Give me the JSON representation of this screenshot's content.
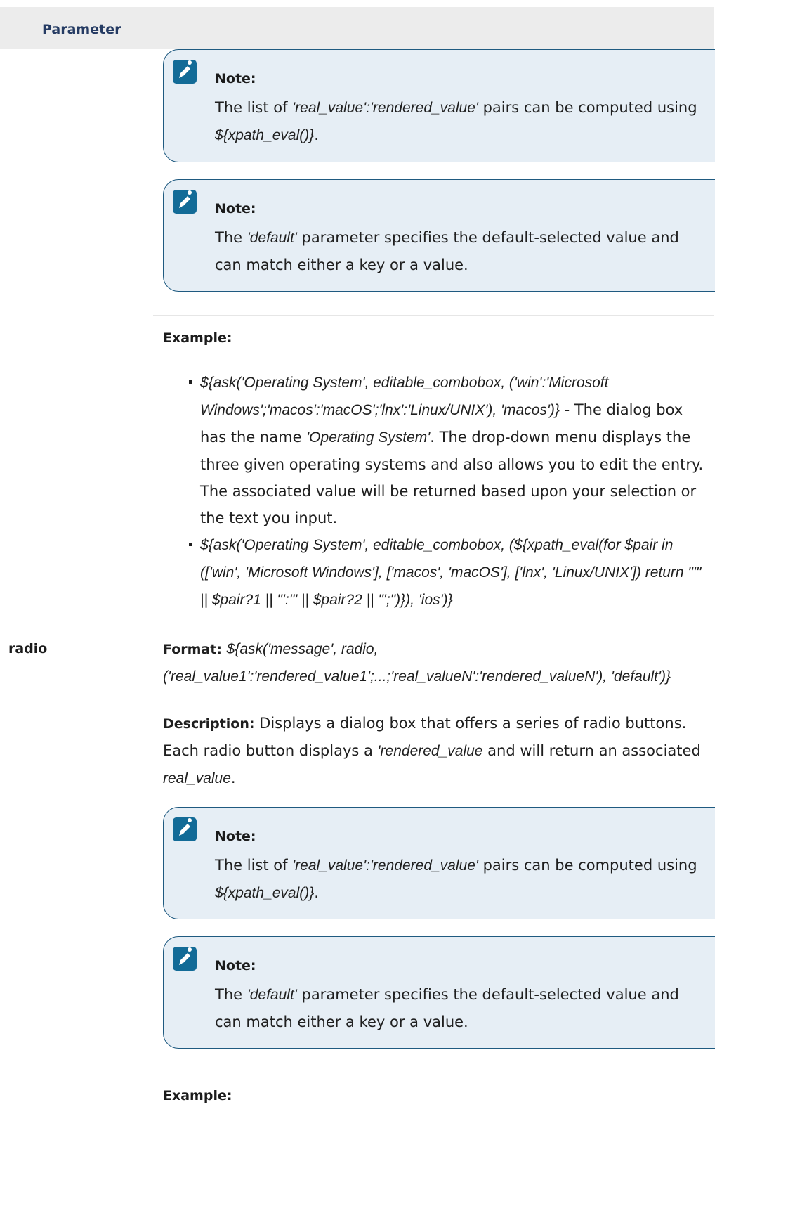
{
  "table": {
    "header": {
      "column1": "Parameter"
    }
  },
  "top_block": {
    "notes": [
      {
        "label": "Note:",
        "text_pre": "The list of ",
        "text_italic": "'real_value':'rendered_value'",
        "text_mid": " pairs can be computed using ",
        "text_italic2": "${xpath_eval()}",
        "text_post": "."
      },
      {
        "label": "Note:",
        "text_pre": "The ",
        "text_italic": "'default'",
        "text_post": " parameter specifies the default-selected value and can match either a key or a value."
      }
    ],
    "example_label": "Example:",
    "examples": [
      {
        "code": "${ask('Operating System', editable_combobox, ('win':'Microsoft Windows';'macos':'macOS';'lnx':'Linux/UNIX'), 'macos')}",
        "desc_pre": " - The dialog box has the name ",
        "desc_italic": "'Operating System'",
        "desc_post": ". The drop-down menu displays the three given operating systems and also allows you to edit the entry. The associated value will be returned based upon your selection or the text you input."
      },
      {
        "code": "${ask('Operating System', editable_combobox, (${xpath_eval(for $pair in (['win', 'Microsoft Windows'], ['macos', 'macOS'], ['lnx', 'Linux/UNIX']) return \"'\" || $pair?1 || \"':'\" || $pair?2 || \"';\")}), 'ios')}"
      }
    ]
  },
  "radio_row": {
    "name": "radio",
    "format_label": "Format:",
    "format_value": "${ask('message', radio, ('real_value1':'rendered_value1';...;'real_valueN':'rendered_valueN'), 'default')}",
    "description_label": "Description:",
    "description_pre": " Displays a dialog box that offers a series of radio buttons. Each radio button displays a ",
    "description_italic": "'rendered_value",
    "description_mid": " and will return an associated ",
    "description_italic2": "real_value",
    "description_post": ".",
    "notes": [
      {
        "label": "Note:",
        "text_pre": "The list of ",
        "text_italic": "'real_value':'rendered_value'",
        "text_mid": " pairs can be computed using ",
        "text_italic2": "${xpath_eval()}",
        "text_post": "."
      },
      {
        "label": "Note:",
        "text_pre": "The ",
        "text_italic": "'default'",
        "text_post": " parameter specifies the default-selected value and can match either a key or a value."
      }
    ],
    "example_label": "Example:"
  },
  "icons": {
    "note": "pencil-note-icon"
  },
  "colors": {
    "note_bg": "#e6eef5",
    "note_border": "#1f5a80",
    "icon_bg": "#136b97",
    "header_text": "#253b63"
  }
}
